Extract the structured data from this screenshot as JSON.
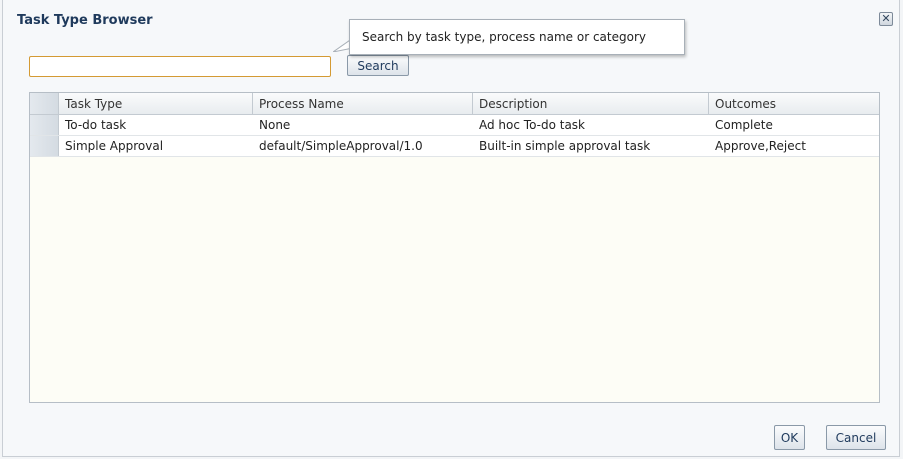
{
  "dialog": {
    "title": "Task Type Browser",
    "close_icon": "close-icon"
  },
  "search": {
    "value": "",
    "button_label": "Search",
    "tooltip": "Search by task type, process name or category"
  },
  "table": {
    "columns": [
      "Task Type",
      "Process Name",
      "Description",
      "Outcomes"
    ],
    "rows": [
      [
        "To-do task",
        "None",
        "Ad hoc To-do task",
        "Complete"
      ],
      [
        "Simple Approval",
        "default/SimpleApproval/1.0",
        "Built-in simple approval task",
        "Approve,Reject"
      ]
    ]
  },
  "footer": {
    "ok_label": "OK",
    "cancel_label": "Cancel"
  },
  "colors": {
    "title": "#1f3a5c",
    "input_focus_border": "#d49a33",
    "table_background": "#fdfdf6"
  }
}
